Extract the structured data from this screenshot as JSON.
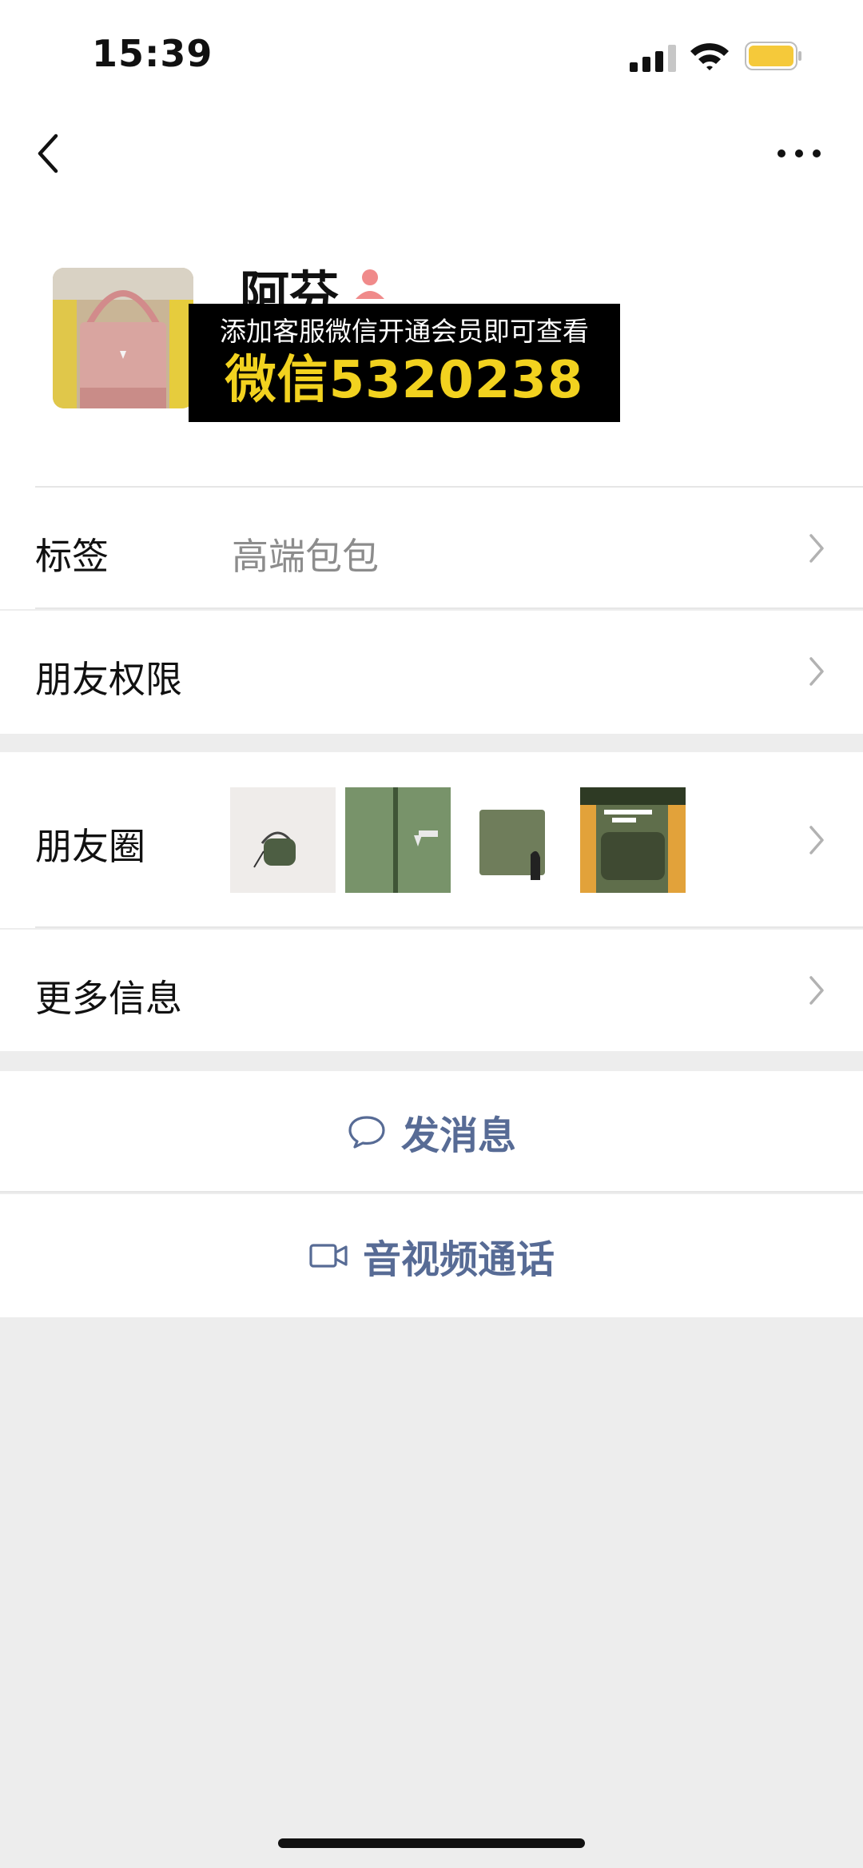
{
  "status_bar": {
    "time": "15:39",
    "signal_icon": "cellular-signal-icon",
    "wifi_icon": "wifi-icon",
    "battery_icon": "battery-icon",
    "battery_color": "#f5c93a"
  },
  "nav": {
    "back_icon": "chevron-left-icon",
    "more_icon": "more-dots-icon"
  },
  "profile": {
    "name": "阿芬",
    "gender_icon": "female-user-icon",
    "gender_color": "#f08a8a",
    "promo_line1": "添加客服微信开通会员即可查看",
    "promo_line2": "微信5320238",
    "promo_highlight_color": "#f2d21f"
  },
  "rows": {
    "tags": {
      "label": "标签",
      "value": "高端包包"
    },
    "permissions": {
      "label": "朋友权限"
    },
    "moments": {
      "label": "朋友圈"
    },
    "more_info": {
      "label": "更多信息"
    }
  },
  "actions": {
    "send_message": {
      "label": "发消息",
      "icon": "chat-bubble-icon"
    },
    "video_call": {
      "label": "音视频通话",
      "icon": "video-camera-icon"
    },
    "link_color": "#576b95"
  }
}
